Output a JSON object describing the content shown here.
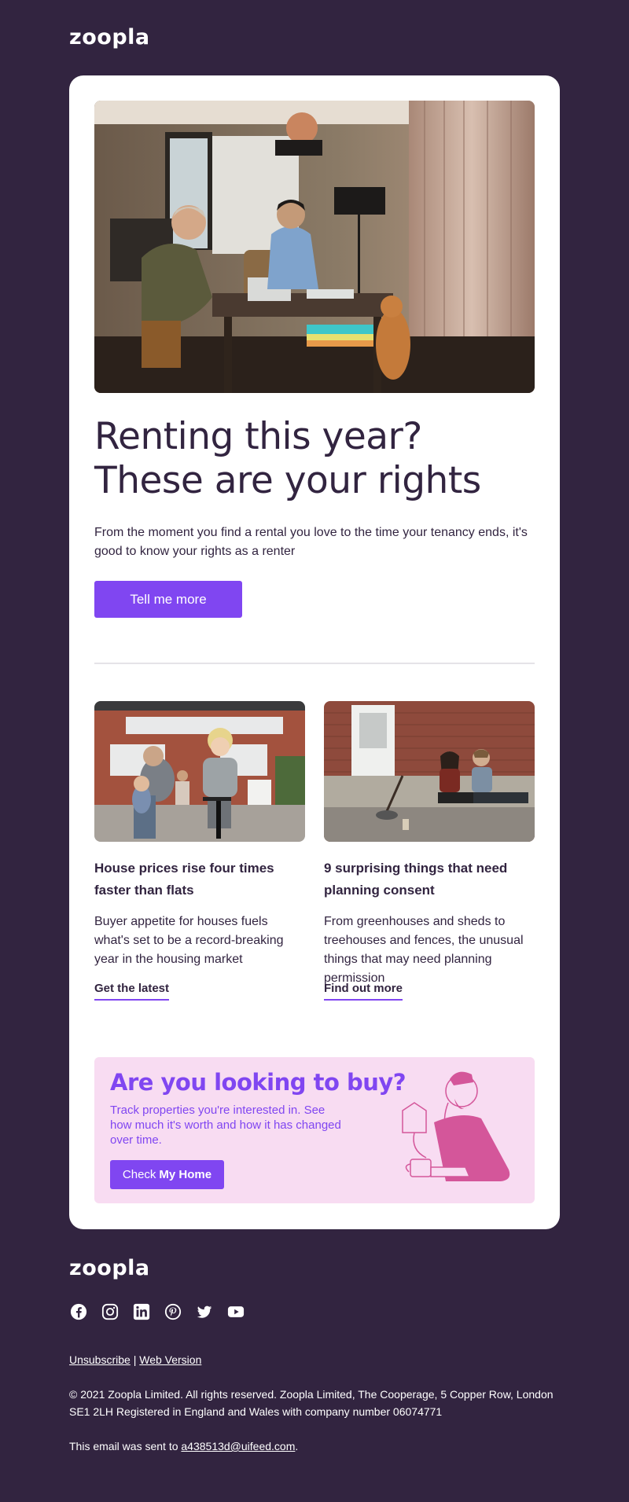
{
  "brand": {
    "logo_text": "zoopla",
    "accent": "#8046f1",
    "background": "#322440",
    "promo_bg": "#f8dcf2"
  },
  "hero": {
    "image_icon": "living-room-photo",
    "title": "Renting this year? These are your rights",
    "description": "From the moment you find a rental you love to the time your tenancy ends, it's good to know your rights as a renter",
    "cta_label": "Tell me more"
  },
  "articles": [
    {
      "image_icon": "family-house-photo",
      "title": "House prices rise four times faster than flats",
      "description": "Buyer appetite for houses fuels what's set to be a record-breaking year in the housing market",
      "link_label": "Get the latest"
    },
    {
      "image_icon": "garden-couple-photo",
      "title": "9 surprising things that need planning consent",
      "description": "From greenhouses and sheds to treehouses and fences, the unusual things that may need planning permission",
      "link_label": "Find out more"
    }
  ],
  "promo": {
    "title": "Are you looking to buy?",
    "description": "Track properties you're interested in. See how much it's worth and how it has changed over time.",
    "button_prefix": "Check",
    "button_strong": "My Home",
    "illustration_icon": "person-with-coffee-illustration"
  },
  "footer": {
    "logo_text": "zoopla",
    "socials": [
      "facebook-icon",
      "instagram-icon",
      "linkedin-icon",
      "pinterest-icon",
      "twitter-icon",
      "youtube-icon"
    ],
    "unsubscribe_label": "Unsubscribe",
    "separator": "|",
    "web_version_label": "Web Version",
    "copyright": "© 2021 Zoopla Limited. All rights reserved. Zoopla Limited, The Cooperage, 5 Copper Row, London SE1 2LH Registered in England and Wales with company number 06074771",
    "sent_prefix": "This email was sent to",
    "email": "a438513d@uifeed.com",
    "sent_suffix": "."
  }
}
